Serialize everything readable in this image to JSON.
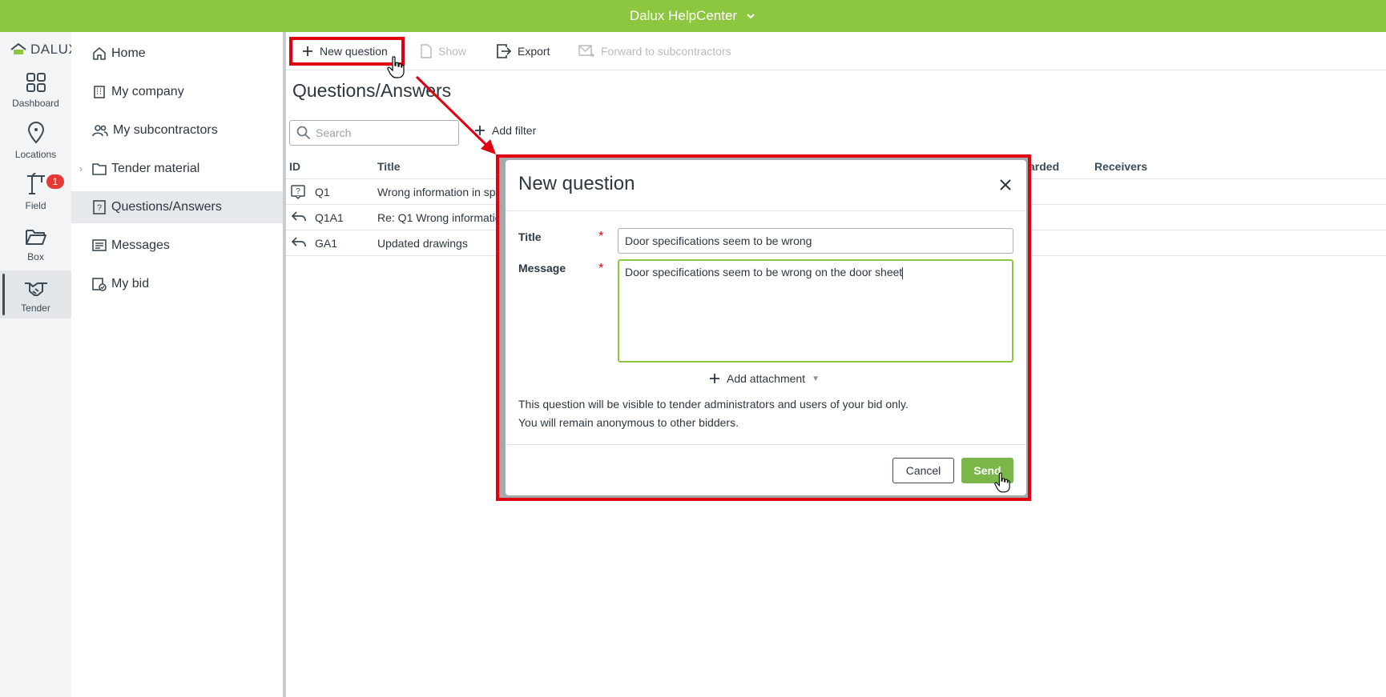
{
  "topbar": {
    "title": "Dalux HelpCenter"
  },
  "rail": {
    "logo": "DALUX",
    "items": [
      {
        "label": "Dashboard",
        "icon": "grid-icon"
      },
      {
        "label": "Locations",
        "icon": "location-pin-icon"
      },
      {
        "label": "Field",
        "icon": "crane-icon",
        "badge": "1"
      },
      {
        "label": "Box",
        "icon": "folder-open-icon"
      },
      {
        "label": "Tender",
        "icon": "handshake-icon",
        "active": true
      }
    ]
  },
  "sidebar": {
    "items": [
      {
        "label": "Home",
        "icon": "home-icon"
      },
      {
        "label": "My company",
        "icon": "building-icon"
      },
      {
        "label": "My subcontractors",
        "icon": "people-icon"
      },
      {
        "label": "Tender material",
        "icon": "folder-icon",
        "expandable": true
      },
      {
        "label": "Questions/Answers",
        "icon": "question-document-icon",
        "active": true
      },
      {
        "label": "Messages",
        "icon": "message-icon"
      },
      {
        "label": "My bid",
        "icon": "bid-icon"
      }
    ]
  },
  "toolbar": {
    "new_question": "New question",
    "show": "Show",
    "export": "Export",
    "forward": "Forward to subcontractors"
  },
  "page": {
    "title": "Questions/Answers",
    "search_placeholder": "Search",
    "add_filter": "Add filter"
  },
  "table": {
    "headers": {
      "id": "ID",
      "title": "Title",
      "forwarded": "arded",
      "receivers": "Receivers"
    },
    "rows": [
      {
        "icon": "question-icon",
        "id": "Q1",
        "title": "Wrong information in sp"
      },
      {
        "icon": "reply-icon",
        "id": "Q1A1",
        "title": "Re: Q1 Wrong informatio"
      },
      {
        "icon": "reply-icon",
        "id": "GA1",
        "title": "Updated drawings"
      }
    ]
  },
  "modal": {
    "heading": "New question",
    "title_label": "Title",
    "title_value": "Door specifications seem to be wrong",
    "message_label": "Message",
    "message_value": "Door specifications seem to be wrong on the door sheet",
    "add_attachment": "Add attachment",
    "note_line1": "This question will be visible to tender administrators and users of your bid only.",
    "note_line2": "You will remain anonymous to other bidders.",
    "cancel": "Cancel",
    "send": "Send"
  },
  "colors": {
    "brand_green": "#8dc63f",
    "send_green": "#7ab648",
    "highlight_red": "#e00012",
    "badge_red": "#e53935"
  }
}
